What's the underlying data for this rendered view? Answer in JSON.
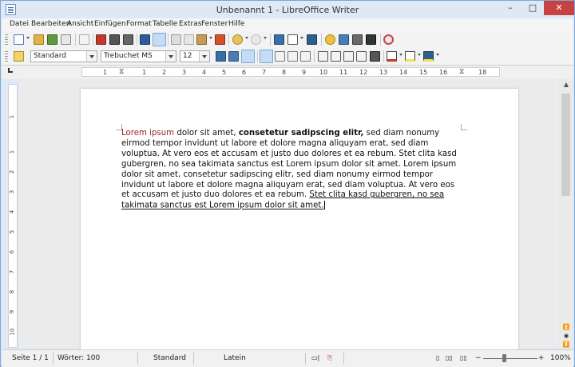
{
  "window": {
    "title": "Unbenannt 1 - LibreOffice Writer",
    "min_glyph": "–",
    "max_glyph": "□",
    "close_glyph": "✕"
  },
  "menu": [
    "Datei",
    "Bearbeiten",
    "Ansicht",
    "Einfügen",
    "Format",
    "Tabelle",
    "Extras",
    "Fenster",
    "Hilfe"
  ],
  "toolbar1_icons": [
    "new-document-icon",
    "open-icon",
    "save-icon",
    "email-icon",
    "edit-icon",
    "export-pdf-icon",
    "print-icon",
    "print-preview-icon",
    "spellcheck-icon",
    "autospellcheck-icon",
    "cut-icon",
    "copy-icon",
    "paste-icon",
    "clone-format-icon",
    "undo-icon",
    "redo-icon",
    "hyperlink-icon",
    "table-icon",
    "show-draw-functions-icon",
    "navigator-icon",
    "gallery-icon",
    "data-sources-icon",
    "formatting-marks-icon",
    "help-icon"
  ],
  "formatting": {
    "paragraph_style": "Standard",
    "font_name": "Trebuchet MS",
    "font_size": "12"
  },
  "toolbar2_icons": [
    "bold-icon",
    "italic-icon",
    "underline-icon",
    "align-left-icon",
    "align-center-icon",
    "align-right-icon",
    "justify-icon",
    "numbering-icon",
    "bullets-icon",
    "decrease-indent-icon",
    "increase-indent-icon",
    "paragraph-direction-icon",
    "font-color-icon",
    "highlighting-icon",
    "background-color-icon"
  ],
  "colors": {
    "accent_red": "#9b2222",
    "close_red": "#c74343",
    "selected_tool": "#c6dcf5"
  },
  "ruler": {
    "h_numbers": [
      "1",
      "1",
      "2",
      "3",
      "4",
      "5",
      "6",
      "7",
      "8",
      "9",
      "10",
      "11",
      "12",
      "13",
      "14",
      "15",
      "16",
      "18"
    ],
    "v_numbers": [
      "1",
      "1",
      "2",
      "3",
      "4",
      "5",
      "6",
      "7",
      "8",
      "9",
      "10"
    ]
  },
  "document": {
    "segments": [
      {
        "text": "Lorem ipsum",
        "style": "red"
      },
      {
        "text": " dolor sit amet, ",
        "style": "normal"
      },
      {
        "text": "consetetur sadipscing elitr,",
        "style": "bold"
      },
      {
        "text": " sed diam nonumy eirmod tempor invidunt ut labore et dolore magna aliquyam erat, sed diam voluptua. At vero eos et accusam et justo duo dolores et ea rebum. Stet clita kasd gubergren, no sea takimata sanctus est Lorem ipsum dolor sit amet. Lorem ipsum dolor sit amet, consetetur sadipscing elitr, sed diam nonumy eirmod tempor invidunt ut labore et dolore magna aliquyam erat, sed diam voluptua. At vero eos et accusam et justo duo dolores et ea rebum. ",
        "style": "normal"
      },
      {
        "text": "Stet clita kasd gubergren, no sea takimata sanctus est Lorem ipsum dolor sit amet.",
        "style": "underline"
      }
    ]
  },
  "status": {
    "page": "Seite 1 / 1",
    "words": "Wörter: 100",
    "page_style": "Standard",
    "language": "Latein",
    "zoom": "100%",
    "zoom_minus": "−",
    "zoom_plus": "+"
  }
}
